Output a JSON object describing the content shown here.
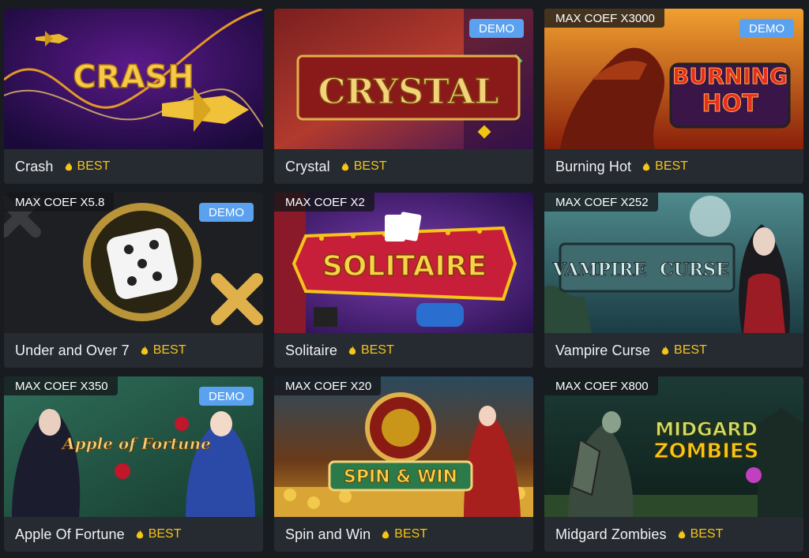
{
  "games": [
    {
      "name": "Crash",
      "badge": "BEST",
      "max_coef": "",
      "demo": ""
    },
    {
      "name": "Crystal",
      "badge": "BEST",
      "max_coef": "",
      "demo": "DEMO"
    },
    {
      "name": "Burning Hot",
      "badge": "BEST",
      "max_coef": "MAX COEF X3000",
      "demo": "DEMO"
    },
    {
      "name": "Under and Over 7",
      "badge": "BEST",
      "max_coef": "MAX COEF X5.8",
      "demo": "DEMO"
    },
    {
      "name": "Solitaire",
      "badge": "BEST",
      "max_coef": "MAX COEF X2",
      "demo": ""
    },
    {
      "name": "Vampire Curse",
      "badge": "BEST",
      "max_coef": "MAX COEF X252",
      "demo": ""
    },
    {
      "name": "Apple Of Fortune",
      "badge": "BEST",
      "max_coef": "MAX COEF X350",
      "demo": "DEMO"
    },
    {
      "name": "Spin and Win",
      "badge": "BEST",
      "max_coef": "MAX COEF X20",
      "demo": ""
    },
    {
      "name": "Midgard Zombies",
      "badge": "BEST",
      "max_coef": "MAX COEF X800",
      "demo": ""
    }
  ],
  "artwork_text": {
    "crash": "CRASH",
    "crystal": "CRYSTAL",
    "burning_hot_1": "BURNING",
    "burning_hot_2": "HOT",
    "solitaire": "SOLITAIRE",
    "vampire_curse": "VAMPIRE",
    "vampire_curse_2": "CURSE",
    "apple_of_fortune": "Apple of Fortune",
    "spin_and_win": "SPIN & WIN",
    "midgard_zombies_1": "MIDGARD",
    "midgard_zombies_2": "ZOMBIES"
  },
  "colors": {
    "page_bg": "#181b20",
    "card_footer": "#262a31",
    "best_accent": "#f5c518",
    "demo_badge": "#5aa2f0"
  },
  "icons": {
    "best": "fire-icon"
  }
}
